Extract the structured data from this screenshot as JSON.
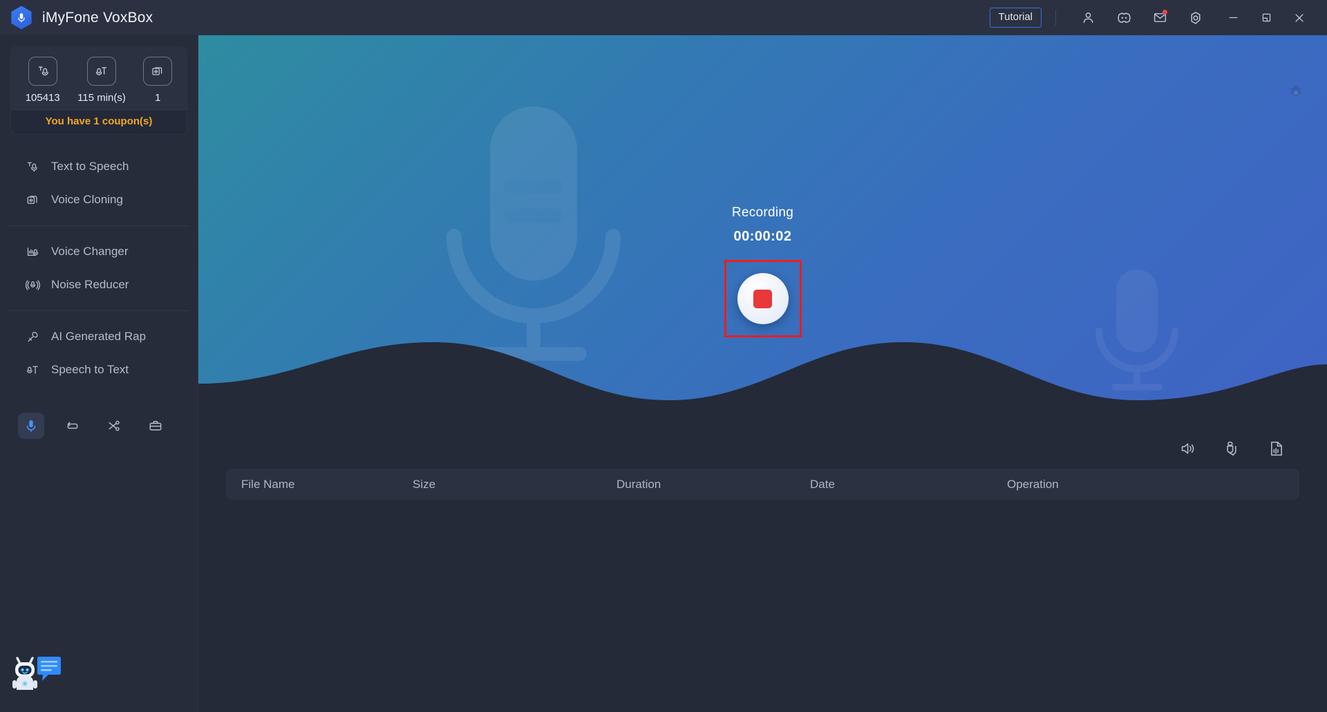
{
  "app": {
    "title": "iMyFone VoxBox",
    "logo_icon": "microphone-hex-logo"
  },
  "titlebar": {
    "tutorial_label": "Tutorial",
    "icons": [
      {
        "name": "account-icon",
        "glyph": "user"
      },
      {
        "name": "community-icon",
        "glyph": "discord"
      },
      {
        "name": "mail-icon",
        "glyph": "envelope",
        "badge": true
      },
      {
        "name": "settings-icon",
        "glyph": "gear"
      }
    ],
    "window_controls": [
      {
        "name": "minimize-button",
        "glyph": "minimize"
      },
      {
        "name": "maximize-button",
        "glyph": "maximize"
      },
      {
        "name": "close-button",
        "glyph": "close"
      }
    ]
  },
  "sidebar": {
    "credits": {
      "items": [
        {
          "icon": "text-to-speech-credit-icon",
          "value": "105413"
        },
        {
          "icon": "speech-to-text-credit-icon",
          "value": "115 min(s)"
        },
        {
          "icon": "voice-cloning-credit-icon",
          "value": "1"
        }
      ],
      "coupon_text": "You have 1 coupon(s)"
    },
    "nav_groups": [
      {
        "items": [
          {
            "label": "Text to Speech",
            "icon": "text-to-speech-icon",
            "active": false
          },
          {
            "label": "Voice Cloning",
            "icon": "voice-cloning-icon",
            "active": false
          }
        ]
      },
      {
        "items": [
          {
            "label": "Voice Changer",
            "icon": "voice-changer-icon",
            "active": false
          },
          {
            "label": "Noise Reducer",
            "icon": "noise-reducer-icon",
            "active": false
          }
        ]
      },
      {
        "items": [
          {
            "label": "AI Generated Rap",
            "icon": "ai-generated-rap-icon",
            "active": false
          },
          {
            "label": "Speech to Text",
            "icon": "speech-to-text-icon",
            "active": false
          }
        ]
      }
    ],
    "tools": [
      {
        "name": "recorder-tool",
        "icon": "microphone-icon",
        "active": true
      },
      {
        "name": "converter-tool",
        "icon": "convert-loop-icon",
        "active": false
      },
      {
        "name": "cutter-tool",
        "icon": "scissors-icon",
        "active": false
      },
      {
        "name": "toolbox-tool",
        "icon": "toolbox-icon",
        "active": false
      }
    ],
    "assistant_icon": "chatbot-assistant-icon"
  },
  "hero": {
    "settings_icon": "recording-settings-gear-icon",
    "watermark_icon": "microphone-watermark",
    "recording_label": "Recording",
    "timer": "00:00:02",
    "stop_button_name": "stop-recording-button",
    "highlight_color": "#ef1e1e",
    "gradient_start": "#2e8ca0",
    "gradient_end": "#3f63c4"
  },
  "file_panel": {
    "tools": [
      {
        "name": "speaker-output-icon",
        "label": "Output device"
      },
      {
        "name": "microphone-input-icon",
        "label": "Input device"
      },
      {
        "name": "audio-file-icon",
        "label": "Open folder"
      }
    ],
    "columns": [
      "File Name",
      "Size",
      "Duration",
      "Date",
      "Operation"
    ],
    "rows": []
  }
}
